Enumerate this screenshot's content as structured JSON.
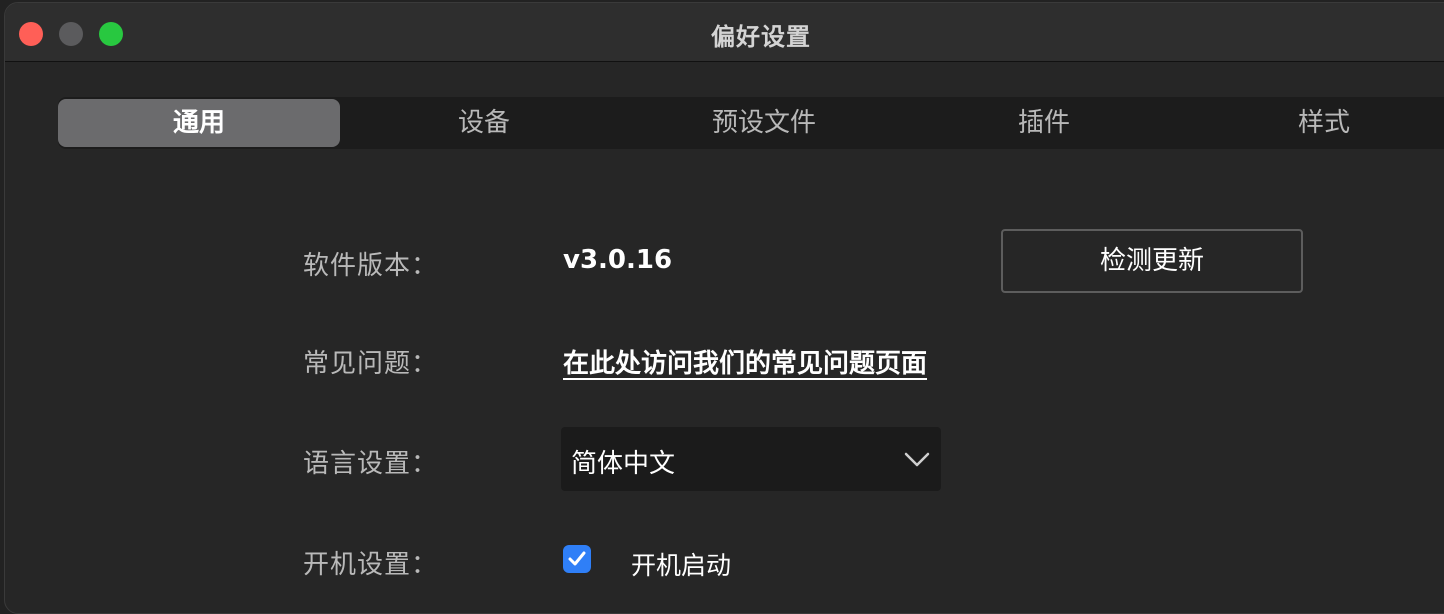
{
  "window": {
    "title": "偏好设置"
  },
  "tabs": [
    {
      "label": "通用",
      "active": true
    },
    {
      "label": "设备",
      "active": false
    },
    {
      "label": "预设文件",
      "active": false
    },
    {
      "label": "插件",
      "active": false
    },
    {
      "label": "样式",
      "active": false
    }
  ],
  "settings": {
    "version": {
      "label": "软件版本：",
      "value": "v3.0.16",
      "button_label": "检测更新"
    },
    "faq": {
      "label": "常见问题：",
      "link_text": "在此处访问我们的常见问题页面"
    },
    "language": {
      "label": "语言设置：",
      "selected": "简体中文"
    },
    "startup": {
      "label": "开机设置：",
      "checkbox_label": "开机启动",
      "checked": true
    }
  },
  "colors": {
    "close": "#ff5f57",
    "minimize_inactive": "#5b5b5d",
    "zoom": "#28c840",
    "accent_checkbox": "#2f7ff7",
    "active_tab": "#6b6b6d"
  }
}
